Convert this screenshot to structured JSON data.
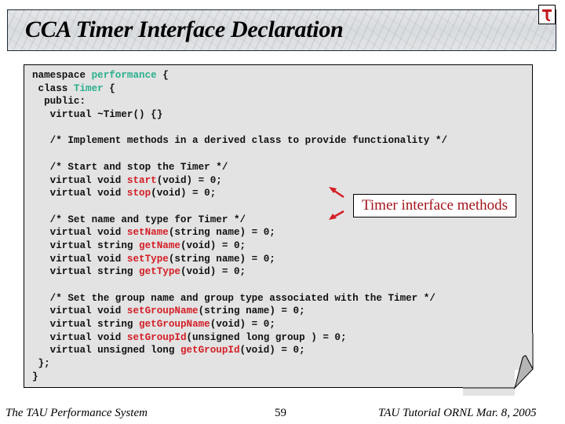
{
  "slide": {
    "title": "CCA Timer Interface Declaration",
    "logo_icon": "tau-logo-icon"
  },
  "code": {
    "lines": [
      [
        {
          "t": "namespace "
        },
        {
          "t": "performance",
          "c": "green"
        },
        {
          "t": " {"
        }
      ],
      [
        {
          "t": " class "
        },
        {
          "t": "Timer",
          "c": "green"
        },
        {
          "t": " {"
        }
      ],
      [
        {
          "t": "  public:"
        }
      ],
      [
        {
          "t": "   virtual ~Timer() {}"
        }
      ],
      [
        {
          "t": ""
        }
      ],
      [
        {
          "t": "   /* Implement methods in a derived class to provide functionality */"
        }
      ],
      [
        {
          "t": ""
        }
      ],
      [
        {
          "t": "   /* Start and stop the Timer */"
        }
      ],
      [
        {
          "t": "   virtual void "
        },
        {
          "t": "start",
          "c": "red"
        },
        {
          "t": "(void) = 0;"
        }
      ],
      [
        {
          "t": "   virtual void "
        },
        {
          "t": "stop",
          "c": "red"
        },
        {
          "t": "(void) = 0;"
        }
      ],
      [
        {
          "t": ""
        }
      ],
      [
        {
          "t": "   /* Set name and type for Timer */"
        }
      ],
      [
        {
          "t": "   virtual void "
        },
        {
          "t": "setName",
          "c": "red"
        },
        {
          "t": "(string name) = 0;"
        }
      ],
      [
        {
          "t": "   virtual string "
        },
        {
          "t": "getName",
          "c": "red"
        },
        {
          "t": "(void) = 0;"
        }
      ],
      [
        {
          "t": "   virtual void "
        },
        {
          "t": "setType",
          "c": "red"
        },
        {
          "t": "(string name) = 0;"
        }
      ],
      [
        {
          "t": "   virtual string "
        },
        {
          "t": "getType",
          "c": "red"
        },
        {
          "t": "(void) = 0;"
        }
      ],
      [
        {
          "t": ""
        }
      ],
      [
        {
          "t": "   /* Set the group name and group type associated with the Timer */"
        }
      ],
      [
        {
          "t": "   virtual void "
        },
        {
          "t": "setGroupName",
          "c": "red"
        },
        {
          "t": "(string name) = 0;"
        }
      ],
      [
        {
          "t": "   virtual string "
        },
        {
          "t": "getGroupName",
          "c": "red"
        },
        {
          "t": "(void) = 0;"
        }
      ],
      [
        {
          "t": "   virtual void "
        },
        {
          "t": "setGroupId",
          "c": "red"
        },
        {
          "t": "(unsigned long group ) = 0;"
        }
      ],
      [
        {
          "t": "   virtual unsigned long "
        },
        {
          "t": "getGroupId",
          "c": "red"
        },
        {
          "t": "(void) = 0;"
        }
      ],
      [
        {
          "t": " };"
        }
      ],
      [
        {
          "t": "}"
        }
      ]
    ]
  },
  "callout": {
    "label": "Timer interface methods"
  },
  "footer": {
    "left": "The TAU Performance System",
    "page_number": "59",
    "right": "TAU Tutorial ORNL Mar. 8, 2005"
  },
  "colors": {
    "keyword_green": "#2ab08c",
    "method_red": "#d41e26",
    "callout_text": "#a3141b",
    "panel_bg": "#e3e3e3"
  }
}
